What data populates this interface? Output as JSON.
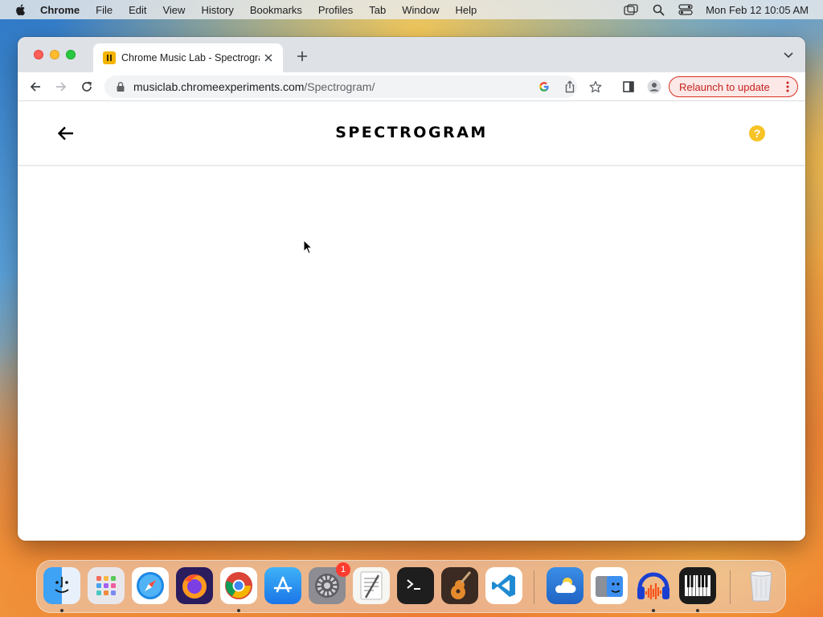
{
  "menubar": {
    "app_name": "Chrome",
    "items": [
      "File",
      "Edit",
      "View",
      "History",
      "Bookmarks",
      "Profiles",
      "Tab",
      "Window",
      "Help"
    ],
    "status_icons": [
      "window-switcher-icon",
      "spotlight-search-icon",
      "control-center-icon"
    ],
    "clock": "Mon Feb 12  10:05 AM"
  },
  "browser": {
    "tab": {
      "title": "Chrome Music Lab - Spectrogram",
      "favicon": "music-lab-favicon-icon"
    },
    "address": {
      "domain": "musiclab.chromeexperiments.com",
      "path": "/Spectrogram/"
    },
    "relaunch_label": "Relaunch to update",
    "colors": {
      "relaunch_text": "#c5221f",
      "relaunch_bg": "#fce8e6"
    }
  },
  "page": {
    "title": "SPECTROGRAM",
    "help_label": "?",
    "colors": {
      "help_accent": "#f7c325"
    }
  },
  "dock": {
    "apps": [
      {
        "name": "Finder",
        "icon": "finder-icon",
        "running": true
      },
      {
        "name": "Launchpad",
        "icon": "launchpad-icon",
        "running": false
      },
      {
        "name": "Safari",
        "icon": "safari-icon",
        "running": false
      },
      {
        "name": "Firefox",
        "icon": "firefox-icon",
        "running": false
      },
      {
        "name": "Google Chrome",
        "icon": "chrome-icon",
        "running": true
      },
      {
        "name": "App Store",
        "icon": "app-store-icon",
        "running": false
      },
      {
        "name": "System Preferences",
        "icon": "system-preferences-icon",
        "running": false,
        "badge": "1"
      },
      {
        "name": "TextEdit",
        "icon": "textedit-icon",
        "running": false
      },
      {
        "name": "Terminal",
        "icon": "terminal-icon",
        "running": false
      },
      {
        "name": "GarageBand",
        "icon": "garageband-icon",
        "running": false
      },
      {
        "name": "Visual Studio Code",
        "icon": "vscode-icon",
        "running": false
      },
      {
        "name": "Weather",
        "icon": "weather-icon",
        "running": false
      },
      {
        "name": "Migration Assistant",
        "icon": "migration-assistant-icon",
        "running": false
      },
      {
        "name": "Audacity",
        "icon": "audacity-icon",
        "running": true
      },
      {
        "name": "Piano",
        "icon": "piano-icon",
        "running": true
      },
      {
        "name": "Trash",
        "icon": "trash-icon",
        "running": false
      }
    ]
  }
}
